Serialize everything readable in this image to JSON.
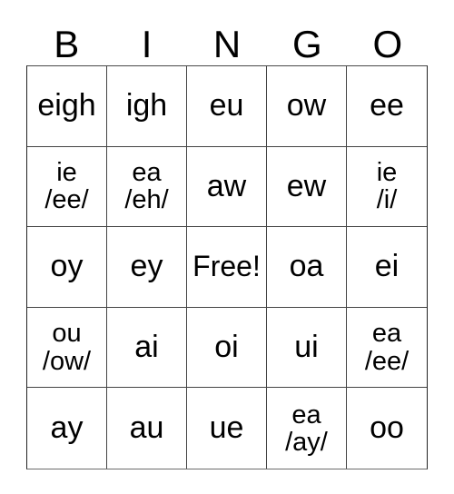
{
  "card": {
    "title": "BINGO",
    "headers": [
      "B",
      "I",
      "N",
      "G",
      "O"
    ],
    "free_space_label": "Free!",
    "colors": {
      "background": "#ffffff",
      "text": "#000000",
      "border": "#444444"
    },
    "rows": [
      [
        {
          "line1": "eigh",
          "line2": ""
        },
        {
          "line1": "igh",
          "line2": ""
        },
        {
          "line1": "eu",
          "line2": ""
        },
        {
          "line1": "ow",
          "line2": ""
        },
        {
          "line1": "ee",
          "line2": ""
        }
      ],
      [
        {
          "line1": "ie",
          "line2": "/ee/"
        },
        {
          "line1": "ea",
          "line2": "/eh/"
        },
        {
          "line1": "aw",
          "line2": ""
        },
        {
          "line1": "ew",
          "line2": ""
        },
        {
          "line1": "ie",
          "line2": "/i/"
        }
      ],
      [
        {
          "line1": "oy",
          "line2": ""
        },
        {
          "line1": "ey",
          "line2": ""
        },
        {
          "line1": "Free!",
          "line2": ""
        },
        {
          "line1": "oa",
          "line2": ""
        },
        {
          "line1": "ei",
          "line2": ""
        }
      ],
      [
        {
          "line1": "ou",
          "line2": "/ow/"
        },
        {
          "line1": "ai",
          "line2": ""
        },
        {
          "line1": "oi",
          "line2": ""
        },
        {
          "line1": "ui",
          "line2": ""
        },
        {
          "line1": "ea",
          "line2": "/ee/"
        }
      ],
      [
        {
          "line1": "ay",
          "line2": ""
        },
        {
          "line1": "au",
          "line2": ""
        },
        {
          "line1": "ue",
          "line2": ""
        },
        {
          "line1": "ea",
          "line2": "/ay/"
        },
        {
          "line1": "oo",
          "line2": ""
        }
      ]
    ]
  }
}
